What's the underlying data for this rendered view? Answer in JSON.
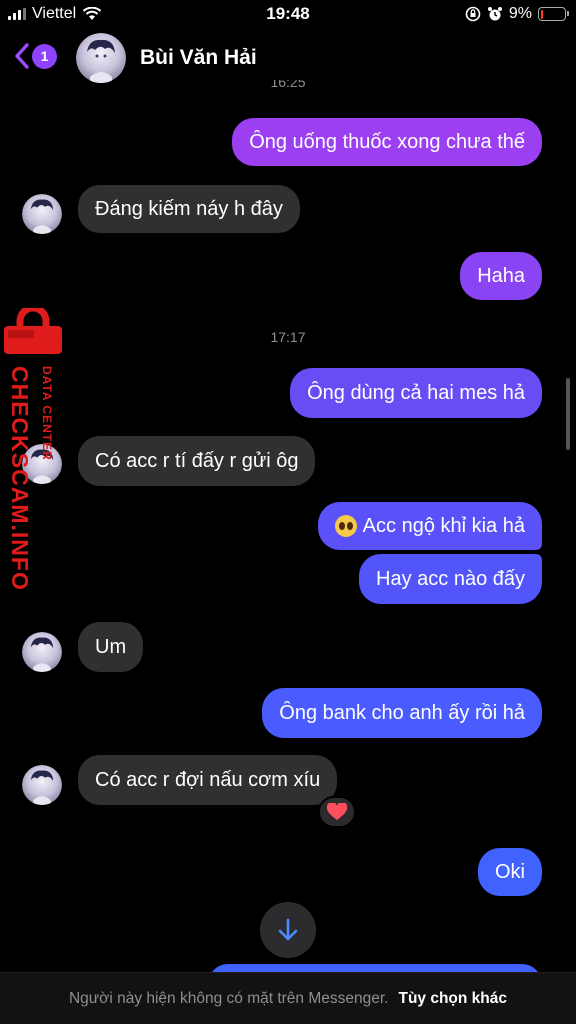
{
  "status_bar": {
    "carrier": "Viettel",
    "time": "19:48",
    "battery": "9%",
    "battery_level": 0.09
  },
  "header": {
    "back_count": "1",
    "contact_name": "Bùi Văn Hải"
  },
  "timestamps": {
    "top_partial": "16:25",
    "middle": "17:17"
  },
  "messages": [
    {
      "dir": "out",
      "text": "Ông uống thuốc xong chưa thế"
    },
    {
      "dir": "in",
      "text": "Đáng kiếm náy h đây"
    },
    {
      "dir": "out",
      "text": "Haha"
    },
    {
      "dir": "out",
      "text": "Ông dùng cả hai mes hả"
    },
    {
      "dir": "in",
      "text": "Có acc r tí đấy r gửi ôg"
    },
    {
      "dir": "out",
      "text": "Acc ngộ khỉ kia hả",
      "emoji": "pleading-face"
    },
    {
      "dir": "out",
      "text": "Hay acc nào đấy"
    },
    {
      "dir": "in",
      "text": "Um"
    },
    {
      "dir": "out",
      "text": "Ông bank cho anh ấy rồi hả"
    },
    {
      "dir": "in",
      "text": "Có acc r đợi nấu cơm xíu",
      "reaction": "heart"
    },
    {
      "dir": "out",
      "text": "Oki"
    }
  ],
  "footer": {
    "note": "Người này hiện không có mặt trên Messenger.",
    "link": "Tùy chọn khác"
  },
  "watermark": {
    "main": "CHECKSCAM.INFO",
    "sub": "DATA CENTER"
  },
  "colors": {
    "bubble_purple": "#9b3ff0",
    "bubble_violet": "#6a4cf5",
    "bubble_blue": "#4a5cff",
    "bubble_incoming": "#303030",
    "accent": "#8e44ff",
    "watermark_red": "#e01b1b"
  }
}
